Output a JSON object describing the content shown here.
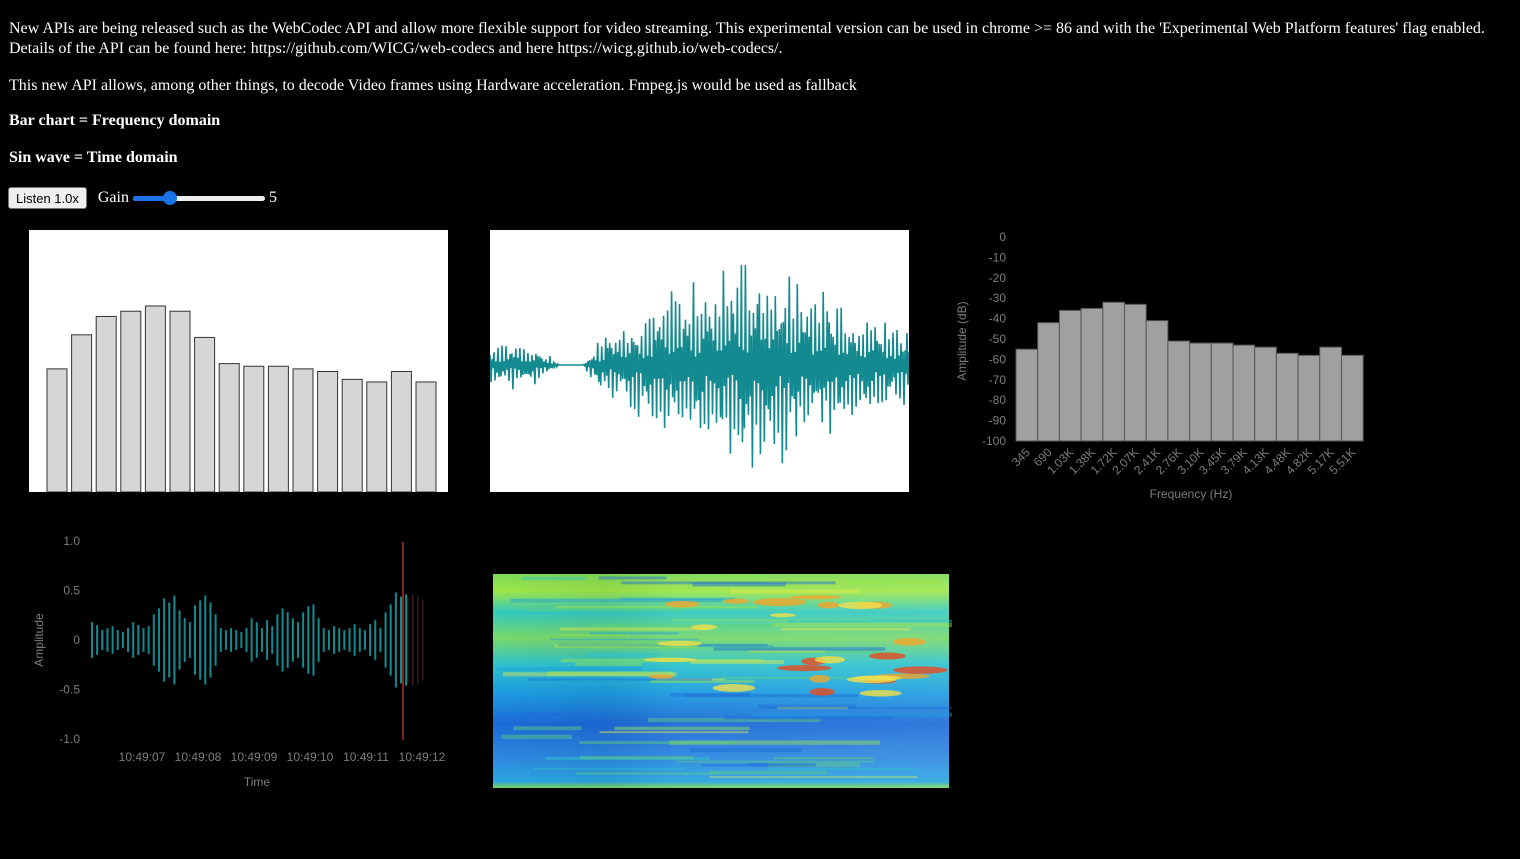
{
  "intro": {
    "paragraph1": "New APIs are being released such as the WebCodec API and allow more flexible support for video streaming. This experimental version can be used in chrome >= 86 and with the 'Experimental Web Platform features' flag enabled. Details of the API can be found here: https://github.com/WICG/web-codecs and here https://wicg.github.io/web-codecs/.",
    "paragraph2": "This new API allows, among other things, to decode Video frames using Hardware acceleration. Fmpeg.js would be used as fallback",
    "legend_bar": "Bar chart = Frequency domain",
    "legend_sin": "Sin wave = Time domain"
  },
  "controls": {
    "listen_label": "Listen 1.0x",
    "gain_label": "Gain",
    "gain_value": "5",
    "gain_fraction": 0.28
  },
  "colors": {
    "teal": "#138a8f",
    "bar_fill_light": "#d6d6d6",
    "bar_fill_dark": "#a0a0a0",
    "axis_text": "#7c7c7c",
    "cursor_line": "#ff4444"
  },
  "chart_data": [
    {
      "type": "bar",
      "name_hint": "frequency-bars-white",
      "values": [
        47,
        60,
        67,
        69,
        71,
        69,
        59,
        49,
        48,
        48,
        47,
        46,
        43,
        42,
        46,
        42
      ]
    },
    {
      "type": "line",
      "name_hint": "time-domain-wave",
      "envelope": [
        0.18,
        0.2,
        0.17,
        0.0,
        0.0,
        0.35,
        0.42,
        0.52,
        0.62,
        0.72,
        0.82,
        0.9,
        0.88,
        0.78,
        0.7,
        0.6,
        0.5,
        0.42,
        0.35
      ]
    },
    {
      "type": "bar",
      "name_hint": "frequency-amplitude-db",
      "xlabel": "Frequency (Hz)",
      "ylabel": "Amplitude (dB)",
      "ylim": [
        -100,
        0
      ],
      "yticks": [
        "0",
        "-10",
        "-20",
        "-30",
        "-40",
        "-50",
        "-60",
        "-70",
        "-80",
        "-90",
        "-100"
      ],
      "categories": [
        "345",
        "690",
        "1.03K",
        "1.38K",
        "1.72K",
        "2.07K",
        "2.41K",
        "2.76K",
        "3.10K",
        "3.45K",
        "3.79K",
        "4.13K",
        "4.48K",
        "4.82K",
        "5.17K",
        "5.51K"
      ],
      "values": [
        -55,
        -42,
        -36,
        -35,
        -32,
        -33,
        -41,
        -51,
        -52,
        -52,
        -53,
        -54,
        -57,
        -58,
        -54,
        -58
      ]
    },
    {
      "type": "bar",
      "name_hint": "amplitude-over-time",
      "xlabel": "Time",
      "ylabel": "Amplitude",
      "ylim": [
        -1.0,
        1.0
      ],
      "yticks": [
        "1.0",
        "0.5",
        "0",
        "-0.5",
        "-1.0"
      ],
      "xticks": [
        "10:49:07",
        "10:49:08",
        "10:49:09",
        "10:49:10",
        "10:49:11",
        "10:49:12"
      ],
      "values": [
        0.18,
        0.15,
        0.1,
        0.12,
        0.14,
        0.1,
        0.08,
        0.12,
        0.18,
        0.15,
        0.12,
        0.14,
        0.26,
        0.32,
        0.42,
        0.38,
        0.45,
        0.3,
        0.22,
        0.18,
        0.35,
        0.4,
        0.45,
        0.38,
        0.26,
        0.12,
        0.1,
        0.12,
        0.1,
        0.08,
        0.12,
        0.22,
        0.18,
        0.12,
        0.2,
        0.14,
        0.26,
        0.32,
        0.28,
        0.22,
        0.18,
        0.28,
        0.34,
        0.36,
        0.22,
        0.12,
        0.1,
        0.14,
        0.12,
        0.1,
        0.12,
        0.16,
        0.12,
        0.1,
        0.16,
        0.2,
        0.12,
        0.28,
        0.36,
        0.48,
        0.44,
        0.46
      ],
      "faded_values": [
        0.42,
        0.46,
        0.44,
        0.4
      ]
    },
    {
      "type": "heatmap",
      "name_hint": "spectrogram"
    }
  ]
}
